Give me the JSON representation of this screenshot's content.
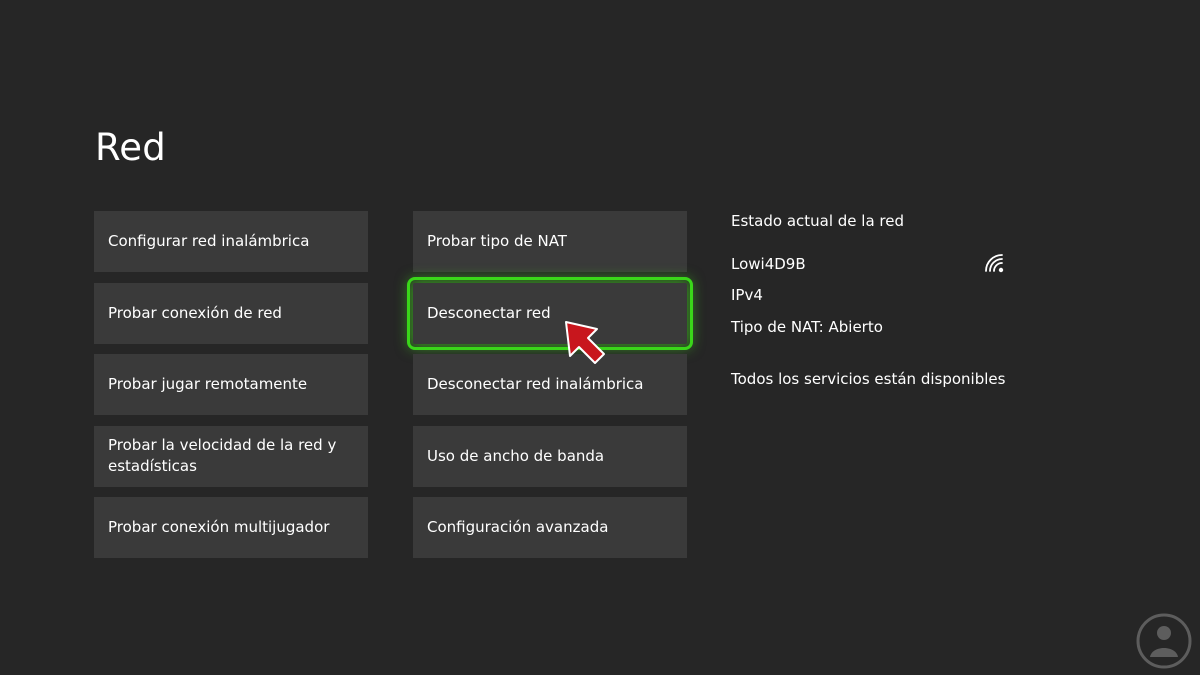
{
  "page": {
    "title": "Red"
  },
  "menu": {
    "column1": [
      {
        "label": "Configurar red inalámbrica"
      },
      {
        "label": "Probar conexión de red"
      },
      {
        "label": "Probar jugar remotamente"
      },
      {
        "label": "Probar la velocidad de la red y estadísticas"
      },
      {
        "label": "Probar conexión multijugador"
      }
    ],
    "column2": [
      {
        "label": "Probar tipo de NAT"
      },
      {
        "label": "Desconectar red",
        "focused": true
      },
      {
        "label": "Desconectar red inalámbrica"
      },
      {
        "label": "Uso de ancho de banda"
      },
      {
        "label": "Configuración avanzada"
      }
    ]
  },
  "status": {
    "heading": "Estado actual de la red",
    "network_name": "Lowi4D9B",
    "ip_version": "IPv4",
    "nat_type": "Tipo de NAT: Abierto",
    "services": "Todos los servicios están disponibles"
  },
  "icons": {
    "network_icon": "wifi-icon",
    "pointer": "red-arrow-pointer-icon",
    "watermark": "solvetic-logo-icon"
  },
  "colors": {
    "background": "#262626",
    "tile": "#3a3a3a",
    "focus": "#3ad61a",
    "pointer": "#c8161d"
  }
}
